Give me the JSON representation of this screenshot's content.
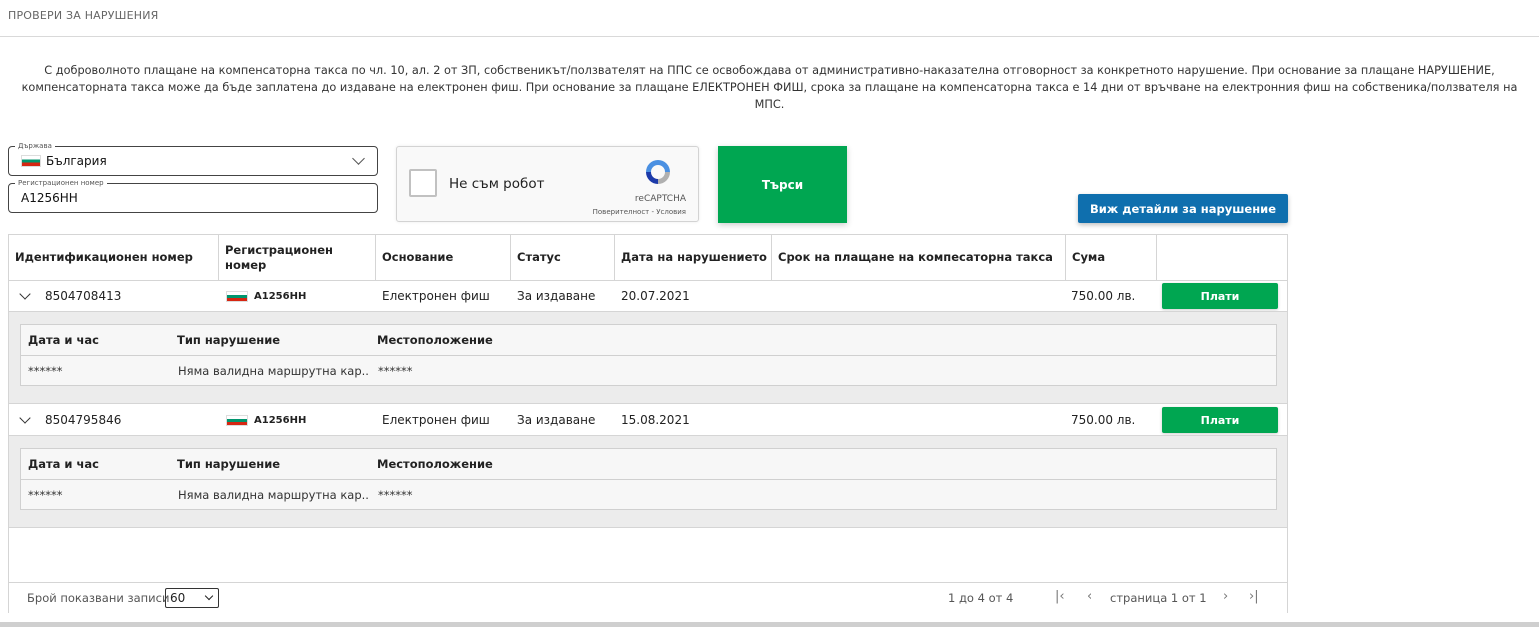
{
  "header": {
    "title": "ПРОВЕРИ ЗА НАРУШЕНИЯ"
  },
  "notice": {
    "line1": "С доброволното плащане на компенсаторна такса по чл. 10, ал. 2 от ЗП, собственикът/ползвателят на ППС се освобождава от административно-наказателна отговорност за конкретното нарушение. При основание за плащане НАРУШЕНИЕ,",
    "line2": "компенсаторната такса може да бъде заплатена до издаване на електронен фиш. При основание за плащане ЕЛЕКТРОНЕН ФИШ, срока за плащане на компенсаторна такса е 14 дни от връчване на електронния фиш на собственика/ползвателя на МПС."
  },
  "form": {
    "country_label": "Държава",
    "country_value": "България",
    "reg_label": "Регистрационен номер",
    "reg_value": "A1256HH"
  },
  "captcha": {
    "label": "Не съм робот",
    "brand": "reCAPTCHA",
    "terms": "Поверителност - Условия"
  },
  "buttons": {
    "search": "Търси",
    "details": "Виж детайли за нарушение",
    "pay": "Плати"
  },
  "table": {
    "columns": [
      "Идентификационен номер",
      "Регистрационен номер",
      "Основание",
      "Статус",
      "Дата на нарушението",
      "Срок на плащане на компесаторна такса",
      "Сума"
    ],
    "rows": [
      {
        "id": "8504708413",
        "plate": "A1256HH",
        "basis": "Електронен фиш",
        "status": "За издаване",
        "date": "20.07.2021",
        "deadline": "",
        "amount": "750.00 лв."
      },
      {
        "id": "8504795846",
        "plate": "A1256HH",
        "basis": "Електронен фиш",
        "status": "За издаване",
        "date": "15.08.2021",
        "deadline": "",
        "amount": "750.00 лв."
      }
    ],
    "detail_columns": [
      "Дата и час",
      "Тип нарушение",
      "Местоположение"
    ],
    "details": [
      {
        "datetime": "******",
        "type": "Няма валидна маршрутна кар...",
        "location": "******"
      },
      {
        "datetime": "******",
        "type": "Няма валидна маршрутна кар...",
        "location": "******"
      }
    ]
  },
  "footer": {
    "page_size_label": "Брой показвани записи",
    "page_size": "60",
    "summary": "1 до 4 от 4",
    "page_info": "страница 1 от 1",
    "first": "|‹",
    "prev": "‹",
    "next": "›",
    "last": "›|"
  },
  "colors": {
    "green": "#00a651",
    "blue": "#0f6fae"
  }
}
